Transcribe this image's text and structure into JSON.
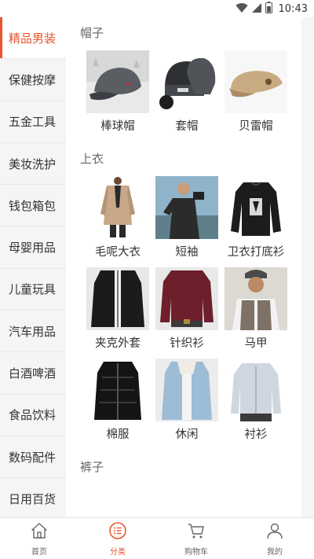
{
  "status_bar": {
    "time": "10:43",
    "icons": [
      "wifi-icon",
      "signal-icon",
      "battery-icon"
    ]
  },
  "colors": {
    "accent": "#e8562f",
    "sidebar_bg": "#f5f5f5"
  },
  "sidebar": {
    "items": [
      {
        "label": "精品男装",
        "active": true
      },
      {
        "label": "保健按摩"
      },
      {
        "label": "五金工具"
      },
      {
        "label": "美妆洗护"
      },
      {
        "label": "钱包箱包"
      },
      {
        "label": "母婴用品"
      },
      {
        "label": "儿童玩具"
      },
      {
        "label": "汽车用品"
      },
      {
        "label": "白酒啤酒"
      },
      {
        "label": "食品饮料"
      },
      {
        "label": "数码配件"
      },
      {
        "label": "日用百货"
      }
    ]
  },
  "sections": [
    {
      "title": "帽子",
      "items": [
        {
          "label": "棒球帽",
          "icon": "baseball-cap-image"
        },
        {
          "label": "套帽",
          "icon": "beanie-image"
        },
        {
          "label": "贝雷帽",
          "icon": "beret-image"
        }
      ]
    },
    {
      "title": "上衣",
      "items": [
        {
          "label": "毛呢大衣",
          "icon": "wool-coat-image"
        },
        {
          "label": "短袖",
          "icon": "tshirt-image"
        },
        {
          "label": "卫衣打底衫",
          "icon": "sweatshirt-image"
        },
        {
          "label": "夹克外套",
          "icon": "jacket-image"
        },
        {
          "label": "针织衫",
          "icon": "knit-sweater-image"
        },
        {
          "label": "马甲",
          "icon": "vest-image"
        },
        {
          "label": "棉服",
          "icon": "padded-coat-image"
        },
        {
          "label": "休闲",
          "icon": "casual-jacket-image"
        },
        {
          "label": "衬衫",
          "icon": "shirt-image"
        }
      ]
    },
    {
      "title": "裤子",
      "items": []
    }
  ],
  "bottom_nav": {
    "items": [
      {
        "label": "首页",
        "icon": "home-icon"
      },
      {
        "label": "分类",
        "icon": "category-icon",
        "active": true
      },
      {
        "label": "购物车",
        "icon": "cart-icon"
      },
      {
        "label": "我的",
        "icon": "profile-icon"
      }
    ]
  }
}
